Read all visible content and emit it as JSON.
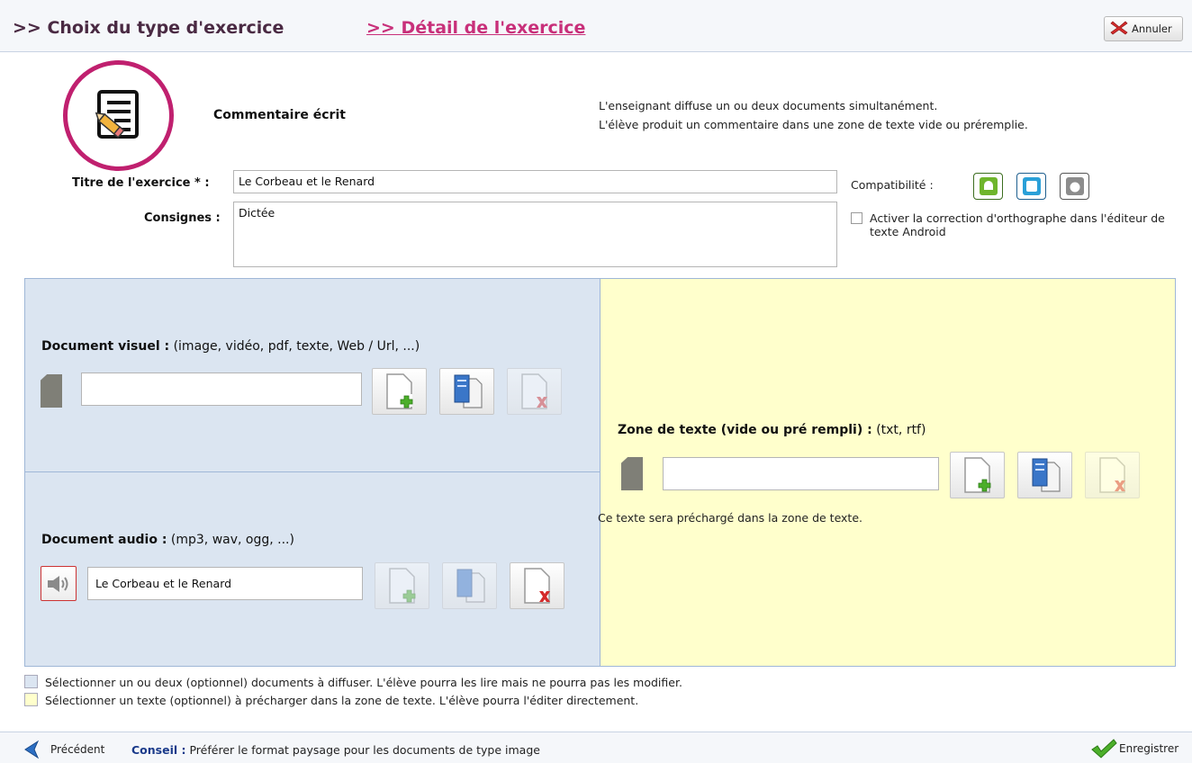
{
  "header": {
    "step1": ">> Choix du type d'exercice",
    "step2": ">> Détail de l'exercice",
    "cancel_label": "Annuler"
  },
  "exercise_type": {
    "name": "Commentaire écrit",
    "description_line1": "L'enseignant diffuse un ou deux documents simultanément.",
    "description_line2": "L'élève produit un commentaire dans une zone de texte vide ou préremplie."
  },
  "form": {
    "title_label": "Titre de l'exercice * :",
    "title_value": "Le Corbeau et le Renard",
    "instructions_label": "Consignes :",
    "instructions_value": "Dictée",
    "compat_label": "Compatibilité :",
    "compat_platforms": [
      "android-icon",
      "windows-icon",
      "apple-icon"
    ],
    "spellcheck_label": "Activer la correction d'orthographe dans l'éditeur de texte Android",
    "spellcheck_checked": false
  },
  "visual_doc": {
    "title": "Document visuel :",
    "formats": "(image, vidéo, pdf, texte, Web / Url, ...)",
    "value": ""
  },
  "audio_doc": {
    "title": "Document audio :",
    "formats": "(mp3, wav, ogg, ...)",
    "value": "Le Corbeau et le Renard"
  },
  "text_zone": {
    "title": "Zone de texte (vide ou pré rempli) :",
    "formats": "(txt, rtf)",
    "value": "",
    "note": "Ce texte sera préchargé dans la zone de texte."
  },
  "legend": {
    "blue_text": "Sélectionner un ou deux (optionnel) documents à diffuser. L'élève pourra les lire mais ne pourra pas les modifier.",
    "yellow_text": "Sélectionner un texte (optionnel) à précharger dans la zone de texte. L'élève pourra l'éditer directement.",
    "blue_color": "#dbe5f1",
    "yellow_color": "#ffffcc"
  },
  "footer": {
    "prev_label": "Précédent",
    "tip_label": "Conseil :",
    "tip_text": "Préférer le format paysage pour les documents de type image",
    "save_label": "Enregistrer"
  },
  "colors": {
    "accent": "#c0206f",
    "title_dark": "#4a2a43",
    "link": "#c8307a"
  }
}
